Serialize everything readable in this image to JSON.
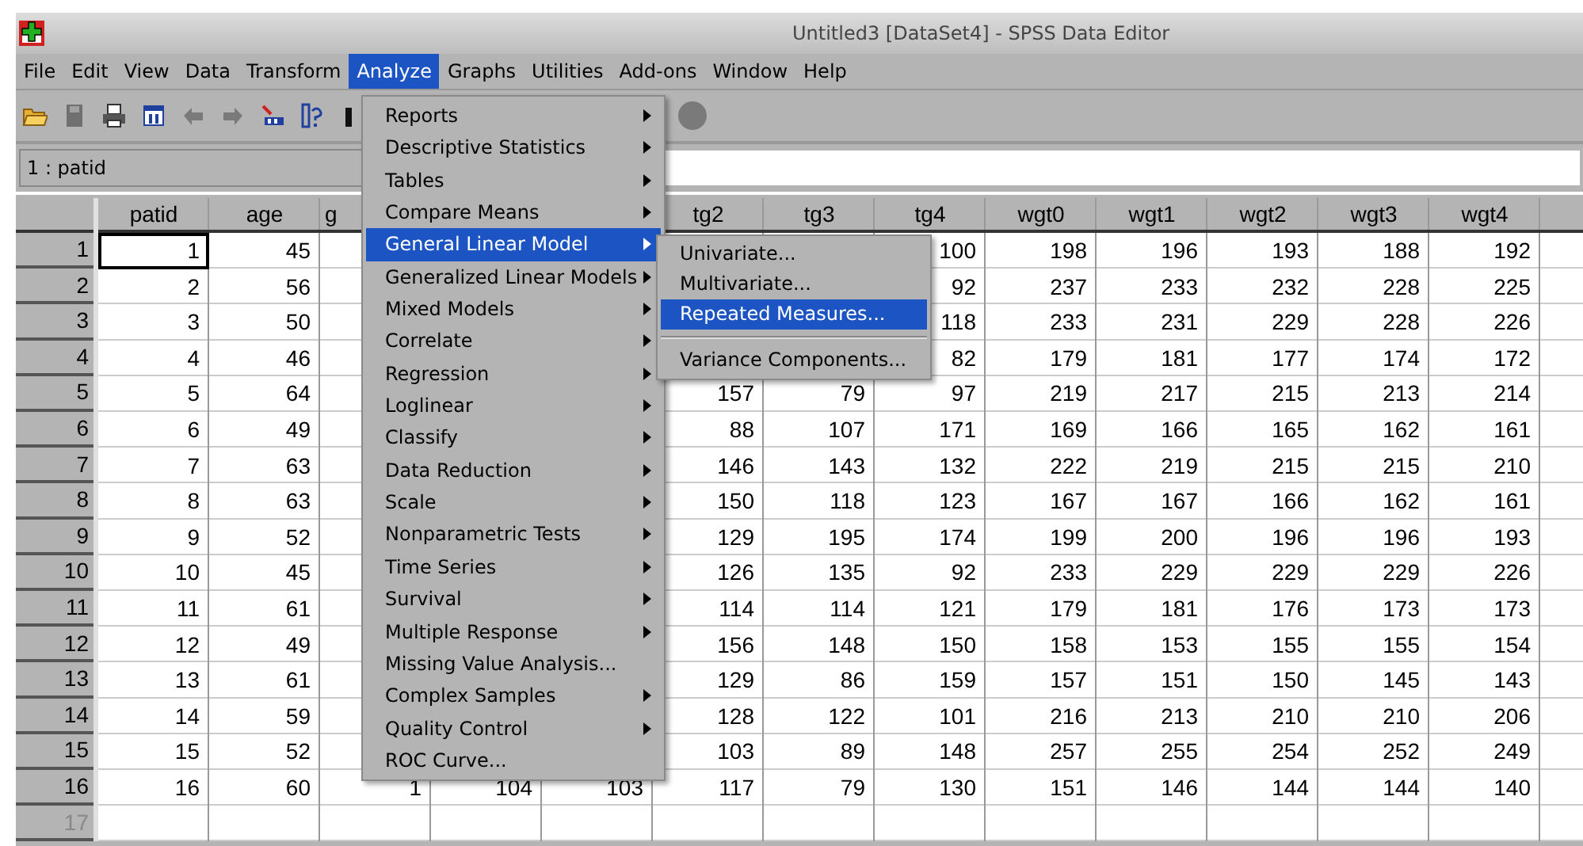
{
  "window": {
    "title": "Untitled3 [DataSet4] - SPSS Data Editor"
  },
  "menubar": [
    {
      "label": "File",
      "selected": false
    },
    {
      "label": "Edit",
      "selected": false
    },
    {
      "label": "View",
      "selected": false
    },
    {
      "label": "Data",
      "selected": false
    },
    {
      "label": "Transform",
      "selected": false
    },
    {
      "label": "Analyze",
      "selected": true
    },
    {
      "label": "Graphs",
      "selected": false
    },
    {
      "label": "Utilities",
      "selected": false
    },
    {
      "label": "Add-ons",
      "selected": false
    },
    {
      "label": "Window",
      "selected": false
    },
    {
      "label": "Help",
      "selected": false
    }
  ],
  "cell_reference": "1 : patid",
  "table": {
    "columns": [
      "patid",
      "age",
      "g",
      null,
      null,
      "tg2",
      "tg3",
      "tg4",
      "wgt0",
      "wgt1",
      "wgt2",
      "wgt3",
      "wgt4"
    ],
    "rows": [
      {
        "label": "1",
        "empty": false,
        "cells": [
          "1",
          "45",
          null,
          null,
          null,
          null,
          null,
          "100",
          "198",
          "196",
          "193",
          "188",
          "192"
        ]
      },
      {
        "label": "2",
        "empty": false,
        "cells": [
          "2",
          "56",
          null,
          null,
          null,
          null,
          null,
          "92",
          "237",
          "233",
          "232",
          "228",
          "225"
        ]
      },
      {
        "label": "3",
        "empty": false,
        "cells": [
          "3",
          "50",
          null,
          null,
          null,
          null,
          null,
          "118",
          "233",
          "231",
          "229",
          "228",
          "226"
        ]
      },
      {
        "label": "4",
        "empty": false,
        "cells": [
          "4",
          "46",
          null,
          null,
          null,
          null,
          null,
          "82",
          "179",
          "181",
          "177",
          "174",
          "172"
        ]
      },
      {
        "label": "5",
        "empty": false,
        "cells": [
          "5",
          "64",
          null,
          null,
          null,
          "157",
          "79",
          "97",
          "219",
          "217",
          "215",
          "213",
          "214"
        ]
      },
      {
        "label": "6",
        "empty": false,
        "cells": [
          "6",
          "49",
          null,
          null,
          null,
          "88",
          "107",
          "171",
          "169",
          "166",
          "165",
          "162",
          "161"
        ]
      },
      {
        "label": "7",
        "empty": false,
        "cells": [
          "7",
          "63",
          null,
          null,
          null,
          "146",
          "143",
          "132",
          "222",
          "219",
          "215",
          "215",
          "210"
        ]
      },
      {
        "label": "8",
        "empty": false,
        "cells": [
          "8",
          "63",
          null,
          null,
          null,
          "150",
          "118",
          "123",
          "167",
          "167",
          "166",
          "162",
          "161"
        ]
      },
      {
        "label": "9",
        "empty": false,
        "cells": [
          "9",
          "52",
          null,
          null,
          null,
          "129",
          "195",
          "174",
          "199",
          "200",
          "196",
          "196",
          "193"
        ]
      },
      {
        "label": "10",
        "empty": false,
        "cells": [
          "10",
          "45",
          null,
          null,
          null,
          "126",
          "135",
          "92",
          "233",
          "229",
          "229",
          "229",
          "226"
        ]
      },
      {
        "label": "11",
        "empty": false,
        "cells": [
          "11",
          "61",
          null,
          null,
          null,
          "114",
          "114",
          "121",
          "179",
          "181",
          "176",
          "173",
          "173"
        ]
      },
      {
        "label": "12",
        "empty": false,
        "cells": [
          "12",
          "49",
          null,
          null,
          null,
          "156",
          "148",
          "150",
          "158",
          "153",
          "155",
          "155",
          "154"
        ]
      },
      {
        "label": "13",
        "empty": false,
        "cells": [
          "13",
          "61",
          null,
          null,
          null,
          "129",
          "86",
          "159",
          "157",
          "151",
          "150",
          "145",
          "143"
        ]
      },
      {
        "label": "14",
        "empty": false,
        "cells": [
          "14",
          "59",
          null,
          null,
          null,
          "128",
          "122",
          "101",
          "216",
          "213",
          "210",
          "210",
          "206"
        ]
      },
      {
        "label": "15",
        "empty": false,
        "cells": [
          "15",
          "52",
          null,
          null,
          null,
          "103",
          "89",
          "148",
          "257",
          "255",
          "254",
          "252",
          "249"
        ]
      },
      {
        "label": "16",
        "empty": false,
        "cells": [
          "16",
          "60",
          "1",
          "104",
          "103",
          "117",
          "79",
          "130",
          "151",
          "146",
          "144",
          "144",
          "140"
        ]
      },
      {
        "label": "17",
        "empty": true
      }
    ]
  },
  "analyze_menu": [
    {
      "label": "Reports",
      "has_submenu": true,
      "selected": false
    },
    {
      "label": "Descriptive Statistics",
      "has_submenu": true,
      "selected": false
    },
    {
      "label": "Tables",
      "has_submenu": true,
      "selected": false
    },
    {
      "label": "Compare Means",
      "has_submenu": true,
      "selected": false
    },
    {
      "label": "General Linear Model",
      "has_submenu": true,
      "selected": true
    },
    {
      "label": "Generalized Linear Models",
      "has_submenu": true,
      "selected": false
    },
    {
      "label": "Mixed Models",
      "has_submenu": true,
      "selected": false
    },
    {
      "label": "Correlate",
      "has_submenu": true,
      "selected": false
    },
    {
      "label": "Regression",
      "has_submenu": true,
      "selected": false
    },
    {
      "label": "Loglinear",
      "has_submenu": true,
      "selected": false
    },
    {
      "label": "Classify",
      "has_submenu": true,
      "selected": false
    },
    {
      "label": "Data Reduction",
      "has_submenu": true,
      "selected": false
    },
    {
      "label": "Scale",
      "has_submenu": true,
      "selected": false
    },
    {
      "label": "Nonparametric Tests",
      "has_submenu": true,
      "selected": false
    },
    {
      "label": "Time Series",
      "has_submenu": true,
      "selected": false
    },
    {
      "label": "Survival",
      "has_submenu": true,
      "selected": false
    },
    {
      "label": "Multiple Response",
      "has_submenu": true,
      "selected": false
    },
    {
      "label": "Missing Value Analysis...",
      "has_submenu": false,
      "selected": false
    },
    {
      "label": "Complex Samples",
      "has_submenu": true,
      "selected": false
    },
    {
      "label": "Quality Control",
      "has_submenu": true,
      "selected": false
    },
    {
      "label": "ROC Curve...",
      "has_submenu": false,
      "selected": false
    }
  ],
  "glm_submenu": [
    {
      "kind": "item",
      "label": "Univariate...",
      "selected": false
    },
    {
      "kind": "item",
      "label": "Multivariate...",
      "selected": false
    },
    {
      "kind": "item",
      "label": "Repeated Measures...",
      "selected": true
    },
    {
      "kind": "separator"
    },
    {
      "kind": "item",
      "label": "Variance Components...",
      "selected": false
    }
  ]
}
